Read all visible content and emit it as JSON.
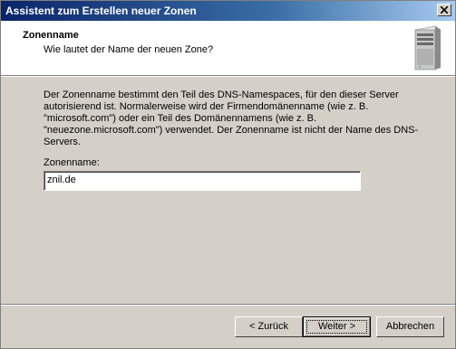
{
  "window": {
    "title": "Assistent zum Erstellen neuer Zonen"
  },
  "header": {
    "title": "Zonenname",
    "subtitle": "Wie lautet der Name der neuen Zone?"
  },
  "body": {
    "description": "Der Zonenname bestimmt den Teil des DNS-Namespaces, für den dieser Server autorisierend ist. Normalerweise wird der Firmendomänenname (wie z. B. \"microsoft.com\") oder ein Teil des Domänennamens (wie z. B. \"neuezone.microsoft.com\") verwendet. Der Zonenname ist nicht der Name des DNS-Servers.",
    "zone_label": "Zonenname:",
    "zone_value": "znil.de"
  },
  "buttons": {
    "back": "< Zurück",
    "next": "Weiter >",
    "cancel": "Abbrechen"
  },
  "icons": {
    "header": "server-icon",
    "close": "close-icon"
  }
}
